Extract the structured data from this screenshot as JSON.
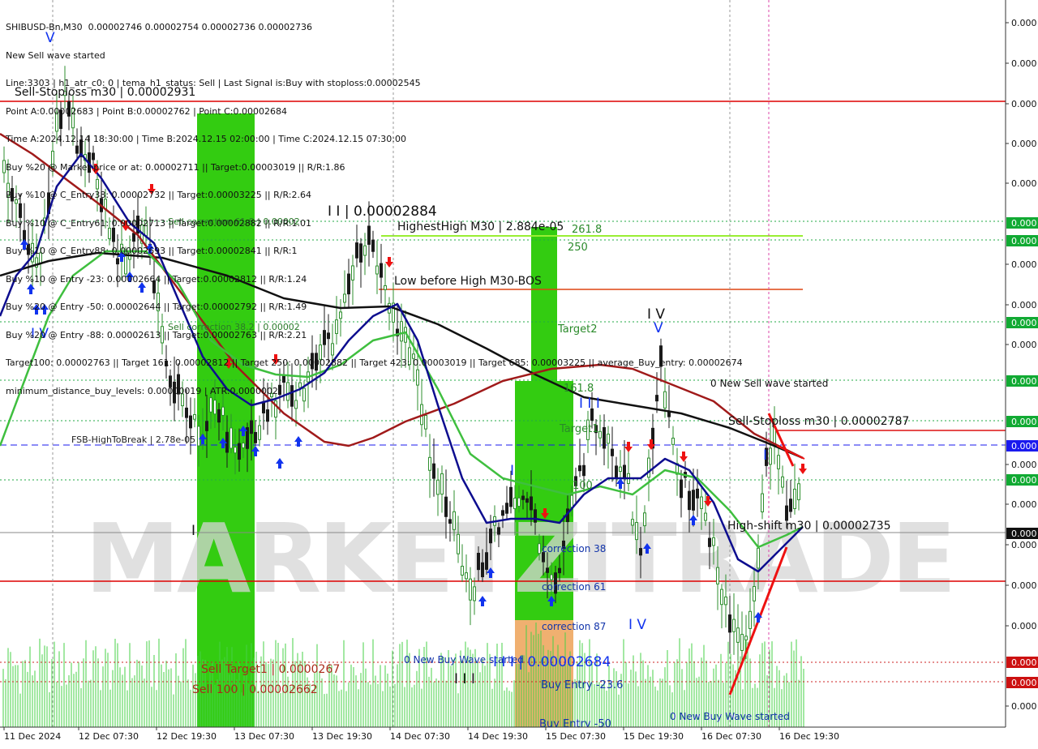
{
  "chart_data": {
    "type": "candlestick",
    "symbol_line": "SHIBUSD-Bn,M30  0.00002746 0.00002754 0.00002736 0.00002736",
    "info_lines": [
      "New Sell wave started",
      "Line:3303 | h1_atr_c0: 0 | tema_h1_status: Sell | Last Signal is:Buy with stoploss:0.00002545",
      "Point A:0.00002683 | Point B:0.00002762 | Point C:0.00002684",
      "Time A:2024.12.14 18:30:00 | Time B:2024.12.15 02:00:00 | Time C:2024.12.15 07:30:00",
      "Buy %20 @ Market price or at: 0.00002711 || Target:0.00003019 || R/R:1.86",
      "Buy %10 @ C_Entry38: 0.00002732 || Target:0.00003225 || R/R:2.64",
      "Buy %10 @ C_Entry61: 0.00002713 || Target:0.00002882 || R/R:1.01",
      "Buy %10 @ C_Entry88: 0.00002693 || Target:0.00002841 || R/R:1",
      "Buy %10 @ Entry -23: 0.00002664 || Target:0.00002812 || R/R:1.24",
      "Buy %20 @ Entry -50: 0.00002644 || Target:0.00002792 || R/R:1.49",
      "Buy %20 @ Entry -88: 0.00002613 || Target:0.00002763 || R/R:2.21",
      "Target100: 0.00002763 || Target 161: 0.00002812 || Target 250: 0.00002882 || Target 423: 0.00003019 || Target 685: 0.00003225 || average_Buy_entry: 0.00002674",
      "minimum_distance_buy_levels: 0.00000019 | ATR:0.0000002"
    ],
    "x_labels": [
      "11 Dec 2024",
      "12 Dec 07:30",
      "12 Dec 19:30",
      "13 Dec 07:30",
      "13 Dec 19:30",
      "14 Dec 07:30",
      "14 Dec 19:30",
      "15 Dec 07:30",
      "15 Dec 19:30",
      "16 Dec 07:30",
      "16 Dec 19:30"
    ],
    "y_labels": [
      "0.000",
      "0.000",
      "0.000",
      "0.000",
      "0.000",
      "0.000",
      "0.000",
      "0.000",
      "0.000",
      "0.000",
      "0.000",
      "0.000",
      "0.000",
      "0.000",
      "0.000",
      "0.000",
      "0.000",
      "0.000",
      "0.000",
      "0.000",
      "0.000",
      "0.000",
      "0.000",
      "0.000",
      "0.000",
      "0.000",
      "0.000",
      "0.000"
    ],
    "annotations": {
      "sell_stoploss_top": "Sell-Stoploss m30 | 0.00002931",
      "sell_correction_618": "Sell correction 61.8 | 0.00002",
      "sell_correction_382": "Sell correction 38.2 | 0.00002",
      "fsb_high_to_break": "FSB-HighToBreak | 2.78e-05",
      "wave_ii_top": "I I | 0.00002884",
      "highest_high": "HighestHigh   M30 | 2.884e-05",
      "fib_2618": "261.8",
      "fib_250": "250",
      "low_before_high": "Low before High   M30-BOS",
      "target2": "Target2",
      "wave_iv_mid": "I V",
      "fib_1618": "161.8",
      "wave_iii_mid": "I I I",
      "target1": "Target1",
      "fib_100": "100",
      "new_sell_wave": "0 New Sell wave started",
      "sell_stoploss_right": "Sell-Stoploss m30 | 0.00002787",
      "high_shift": "High-shift m30 | 0.00002735",
      "correction_38": "correction 38",
      "correction_61": "correction 61",
      "correction_87": "correction 87",
      "wave_iv_low": "I V",
      "new_buy_wave_1": "0 New Buy Wave started",
      "wave_iii_point": "I I I | 0.00002684",
      "buy_entry_236": "Buy Entry -23.6",
      "buy_entry_50": "Buy Entry -50",
      "new_buy_wave_2": "0 New Buy Wave started",
      "sell_target1": "Sell Target1 | 0.0000267",
      "sell_100": "Sell 100 | 0.00002662",
      "wave_iv_left": "I V",
      "wave_v_left": "V",
      "wave_iii_low": "I I I",
      "wave_i_left": "I",
      "wave_i_mid": "I",
      "wave_i_right": "I",
      "wave_v_mid": "V",
      "wave_iv_top_mid": "I V"
    },
    "watermark": "MARKETZITRADE",
    "colors": {
      "background": "#ffffff",
      "bull_candle": "#2f8f2f",
      "bear_candle": "#1a1a1a",
      "ema_fast": "#0d0d8f",
      "ema_mid": "#3fbf3f",
      "ema_red": "#a01a1a",
      "ema_black": "#111111",
      "green_zone": "#33cc11",
      "orange_zone": "#f0b070",
      "red_line": "#dd0000",
      "blue_dash": "#1a1aee",
      "label_green_bg": "#11aa33",
      "label_red_bg": "#cc1111",
      "label_blue_bg": "#1a1aee"
    }
  }
}
